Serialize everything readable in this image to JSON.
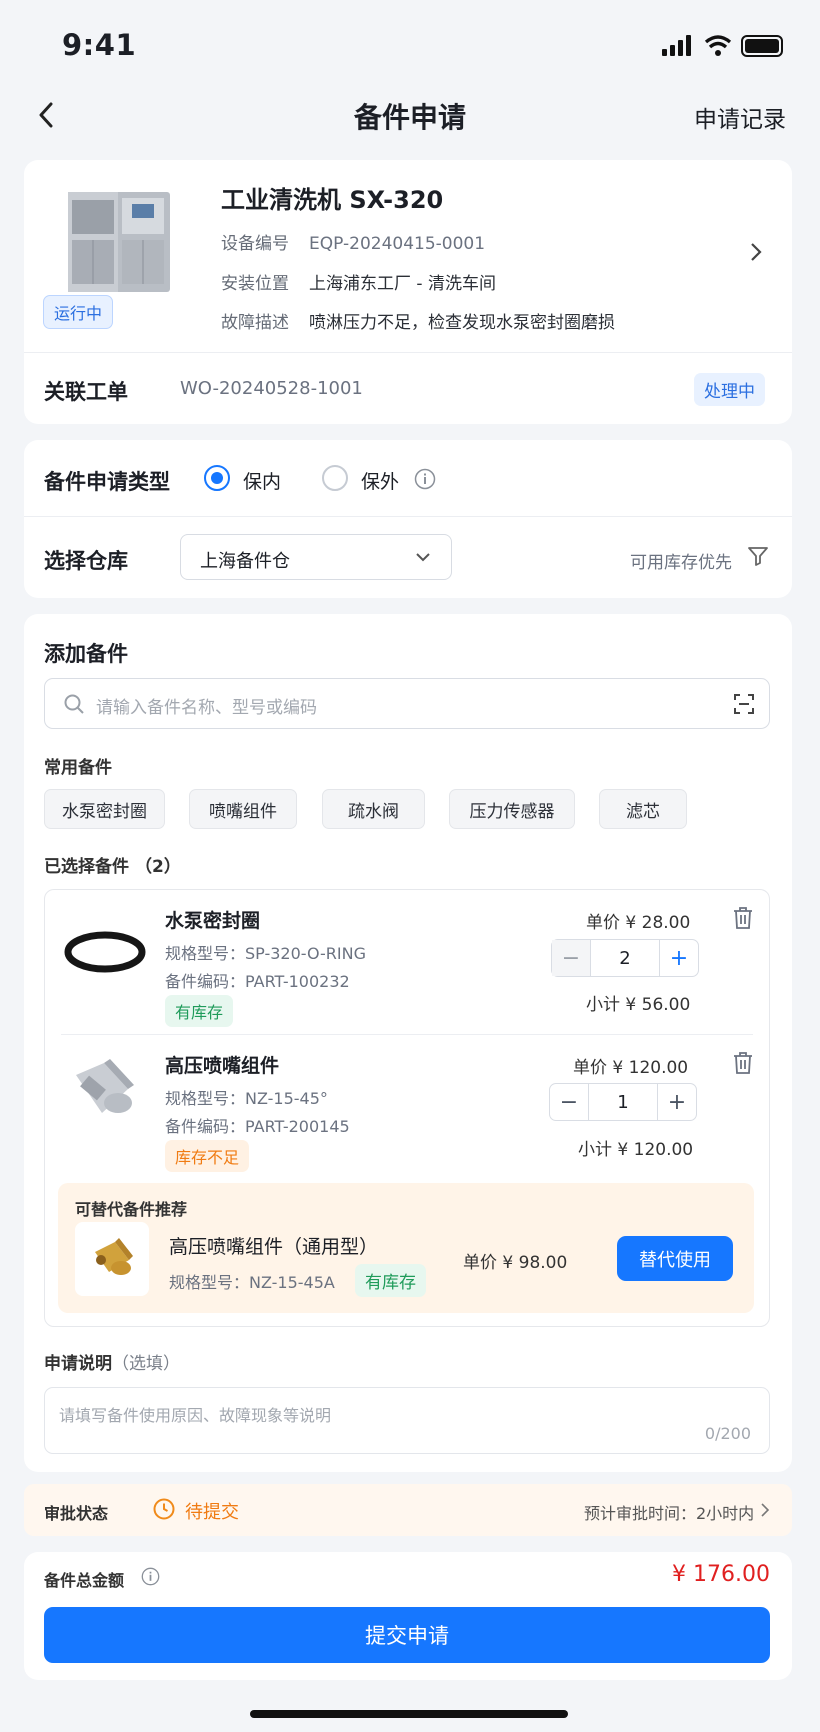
{
  "status_bar": {
    "time": "9:41"
  },
  "nav": {
    "title": "备件申请",
    "right_link": "申请记录"
  },
  "equipment": {
    "name": "工业清洗机 SX-320",
    "status": "运行中",
    "fields": [
      {
        "label": "设备编号",
        "value": "EQP-20240415-0001"
      },
      {
        "label": "安装位置",
        "value": "上海浦东工厂 - 清洗车间"
      },
      {
        "label": "故障描述",
        "value": "喷淋压力不足，检查发现水泵密封圈磨损"
      }
    ]
  },
  "work_order": {
    "label": "关联工单",
    "value": "WO-20240528-1001",
    "status": "处理中"
  },
  "apply_type": {
    "label": "备件申请类型",
    "options": [
      "保内",
      "保外"
    ],
    "selected": "保内"
  },
  "warehouse": {
    "label": "选择仓库",
    "value": "上海备件仓",
    "filter_label": "可用库存优先"
  },
  "add_parts": {
    "title": "添加备件",
    "search_placeholder": "请输入备件名称、型号或编码",
    "common_title": "常用备件",
    "common_items": [
      "水泵密封圈",
      "喷嘴组件",
      "疏水阀",
      "压力传感器",
      "滤芯"
    ],
    "selected_title": "已选择备件",
    "selected_count": "（2）"
  },
  "selected_parts": [
    {
      "name": "水泵密封圈",
      "spec": "规格型号：SP-320-O-RING",
      "code": "备件编码：PART-100232",
      "stock": "有库存",
      "unit_price": "单价 ¥ 28.00",
      "qty": "2",
      "subtotal": "小计 ¥ 56.00"
    },
    {
      "name": "高压喷嘴组件",
      "spec": "规格型号：NZ-15-45°",
      "code": "备件编码：PART-200145",
      "stock": "库存不足",
      "unit_price": "单价 ¥ 120.00",
      "qty": "1",
      "subtotal": "小计 ¥ 120.00"
    }
  ],
  "alternative": {
    "title": "可替代备件推荐",
    "name": "高压喷嘴组件（通用型）",
    "spec": "规格型号：NZ-15-45A",
    "stock": "有库存",
    "unit_price": "单价 ¥ 98.00",
    "button": "替代使用"
  },
  "remark": {
    "title": "申请说明",
    "optional": "（选填）",
    "placeholder": "请填写备件使用原因、故障现象等说明",
    "counter": "0/200"
  },
  "approval": {
    "label": "审批状态",
    "status": "待提交",
    "estimate": "预计审批时间：2小时内"
  },
  "total": {
    "label": "备件总金额",
    "amount": "¥ 176.00"
  },
  "submit": {
    "label": "提交申请"
  },
  "colors": {
    "primary": "#1677ff",
    "warn": "#f07b12",
    "price": "#e02020"
  }
}
